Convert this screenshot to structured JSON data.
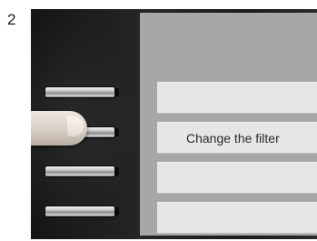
{
  "step": {
    "number": "2"
  },
  "menu": {
    "items": [
      {
        "label": ""
      },
      {
        "label": "Change the filter"
      },
      {
        "label": ""
      },
      {
        "label": ""
      }
    ],
    "selected_index": 1
  },
  "device": {
    "soft_keys": 4,
    "pressed_key_index": 1
  },
  "colors": {
    "screen_background": "#a7a7a7",
    "button_background": "#e6e6e6",
    "bezel": "#1c1c1c"
  }
}
